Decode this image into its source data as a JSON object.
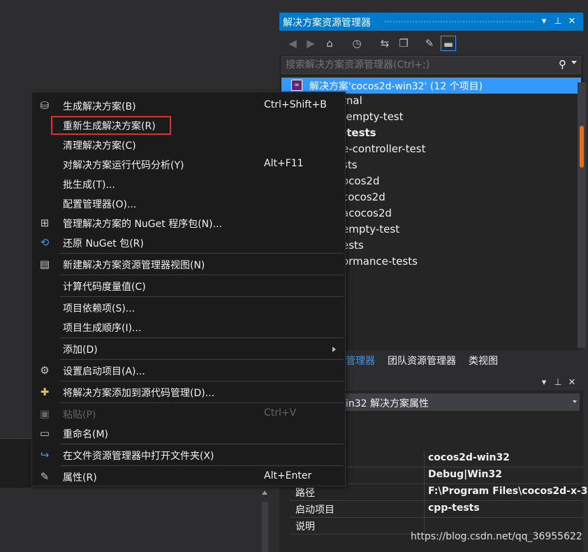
{
  "solution_explorer": {
    "title": "解决方案资源管理器",
    "search_placeholder": "搜索解决方案资源管理器(Ctrl+;)",
    "solution_label": "解决方案'cocos2d-win32' (12 个项目)",
    "projects": [
      "rnal",
      "-empty-test",
      "-tests",
      "e-controller-test",
      "sts",
      "ocos2d",
      "cocos2d",
      "acocos2d",
      "empty-test",
      "ests",
      "ormance-tests"
    ],
    "icons": [
      "back-icon",
      "forward-icon",
      "home-icon",
      "history-icon",
      "sync-icon",
      "collapse-icon",
      "wrench-icon",
      "pin-icon"
    ]
  },
  "bottom_tabs": [
    "管理器",
    "团队资源管理器",
    "类视图"
  ],
  "properties": {
    "object": "in32  解决方案属性",
    "rows": [
      {
        "key": "",
        "value": "cocos2d-win32"
      },
      {
        "key": "",
        "value": "Debug|Win32"
      },
      {
        "key": "路径",
        "value": "F:\\Program Files\\cocos2d-x-3"
      },
      {
        "key": "启动项目",
        "value": "cpp-tests"
      },
      {
        "key": "说明",
        "value": ""
      }
    ]
  },
  "context_menu": {
    "items": [
      {
        "label": "生成解决方案(B)",
        "shortcut": "Ctrl+Shift+B",
        "icon": "build-icon"
      },
      {
        "label": "重新生成解决方案(R)",
        "shortcut": "",
        "icon": ""
      },
      {
        "label": "清理解决方案(C)",
        "shortcut": "",
        "icon": ""
      },
      {
        "label": "对解决方案运行代码分析(Y)",
        "shortcut": "Alt+F11",
        "icon": ""
      },
      {
        "label": "批生成(T)...",
        "shortcut": "",
        "icon": ""
      },
      {
        "label": "配置管理器(O)...",
        "shortcut": "",
        "icon": ""
      },
      {
        "label": "管理解决方案的 NuGet 程序包(N)...",
        "shortcut": "",
        "icon": "nuget-package-icon"
      },
      {
        "label": "还原 NuGet 包(R)",
        "shortcut": "",
        "icon": "restore-icon"
      },
      {
        "label": "新建解决方案资源管理器视图(N)",
        "shortcut": "",
        "icon": "new-view-icon"
      },
      {
        "label": "计算代码度量值(C)",
        "shortcut": "",
        "icon": ""
      },
      {
        "label": "项目依赖项(S)...",
        "shortcut": "",
        "icon": ""
      },
      {
        "label": "项目生成顺序(I)...",
        "shortcut": "",
        "icon": ""
      },
      {
        "label": "添加(D)",
        "shortcut": "",
        "icon": ""
      },
      {
        "label": "设置启动项目(A)...",
        "shortcut": "",
        "icon": "gear-icon"
      },
      {
        "label": "将解决方案添加到源代码管理(D)...",
        "shortcut": "",
        "icon": "source-control-icon"
      },
      {
        "label": "粘贴(P)",
        "shortcut": "Ctrl+V",
        "icon": "paste-icon"
      },
      {
        "label": "重命名(M)",
        "shortcut": "",
        "icon": "rename-icon"
      },
      {
        "label": "在文件资源管理器中打开文件夹(X)",
        "shortcut": "",
        "icon": "open-folder-icon"
      },
      {
        "label": "属性(R)",
        "shortcut": "Alt+Enter",
        "icon": "wrench-icon"
      }
    ]
  },
  "watermark": "https://blog.csdn.net/qq_36955622",
  "colors": {
    "accent": "#007acc",
    "selection": "#3399ff",
    "highlight_box": "#e0302c"
  }
}
